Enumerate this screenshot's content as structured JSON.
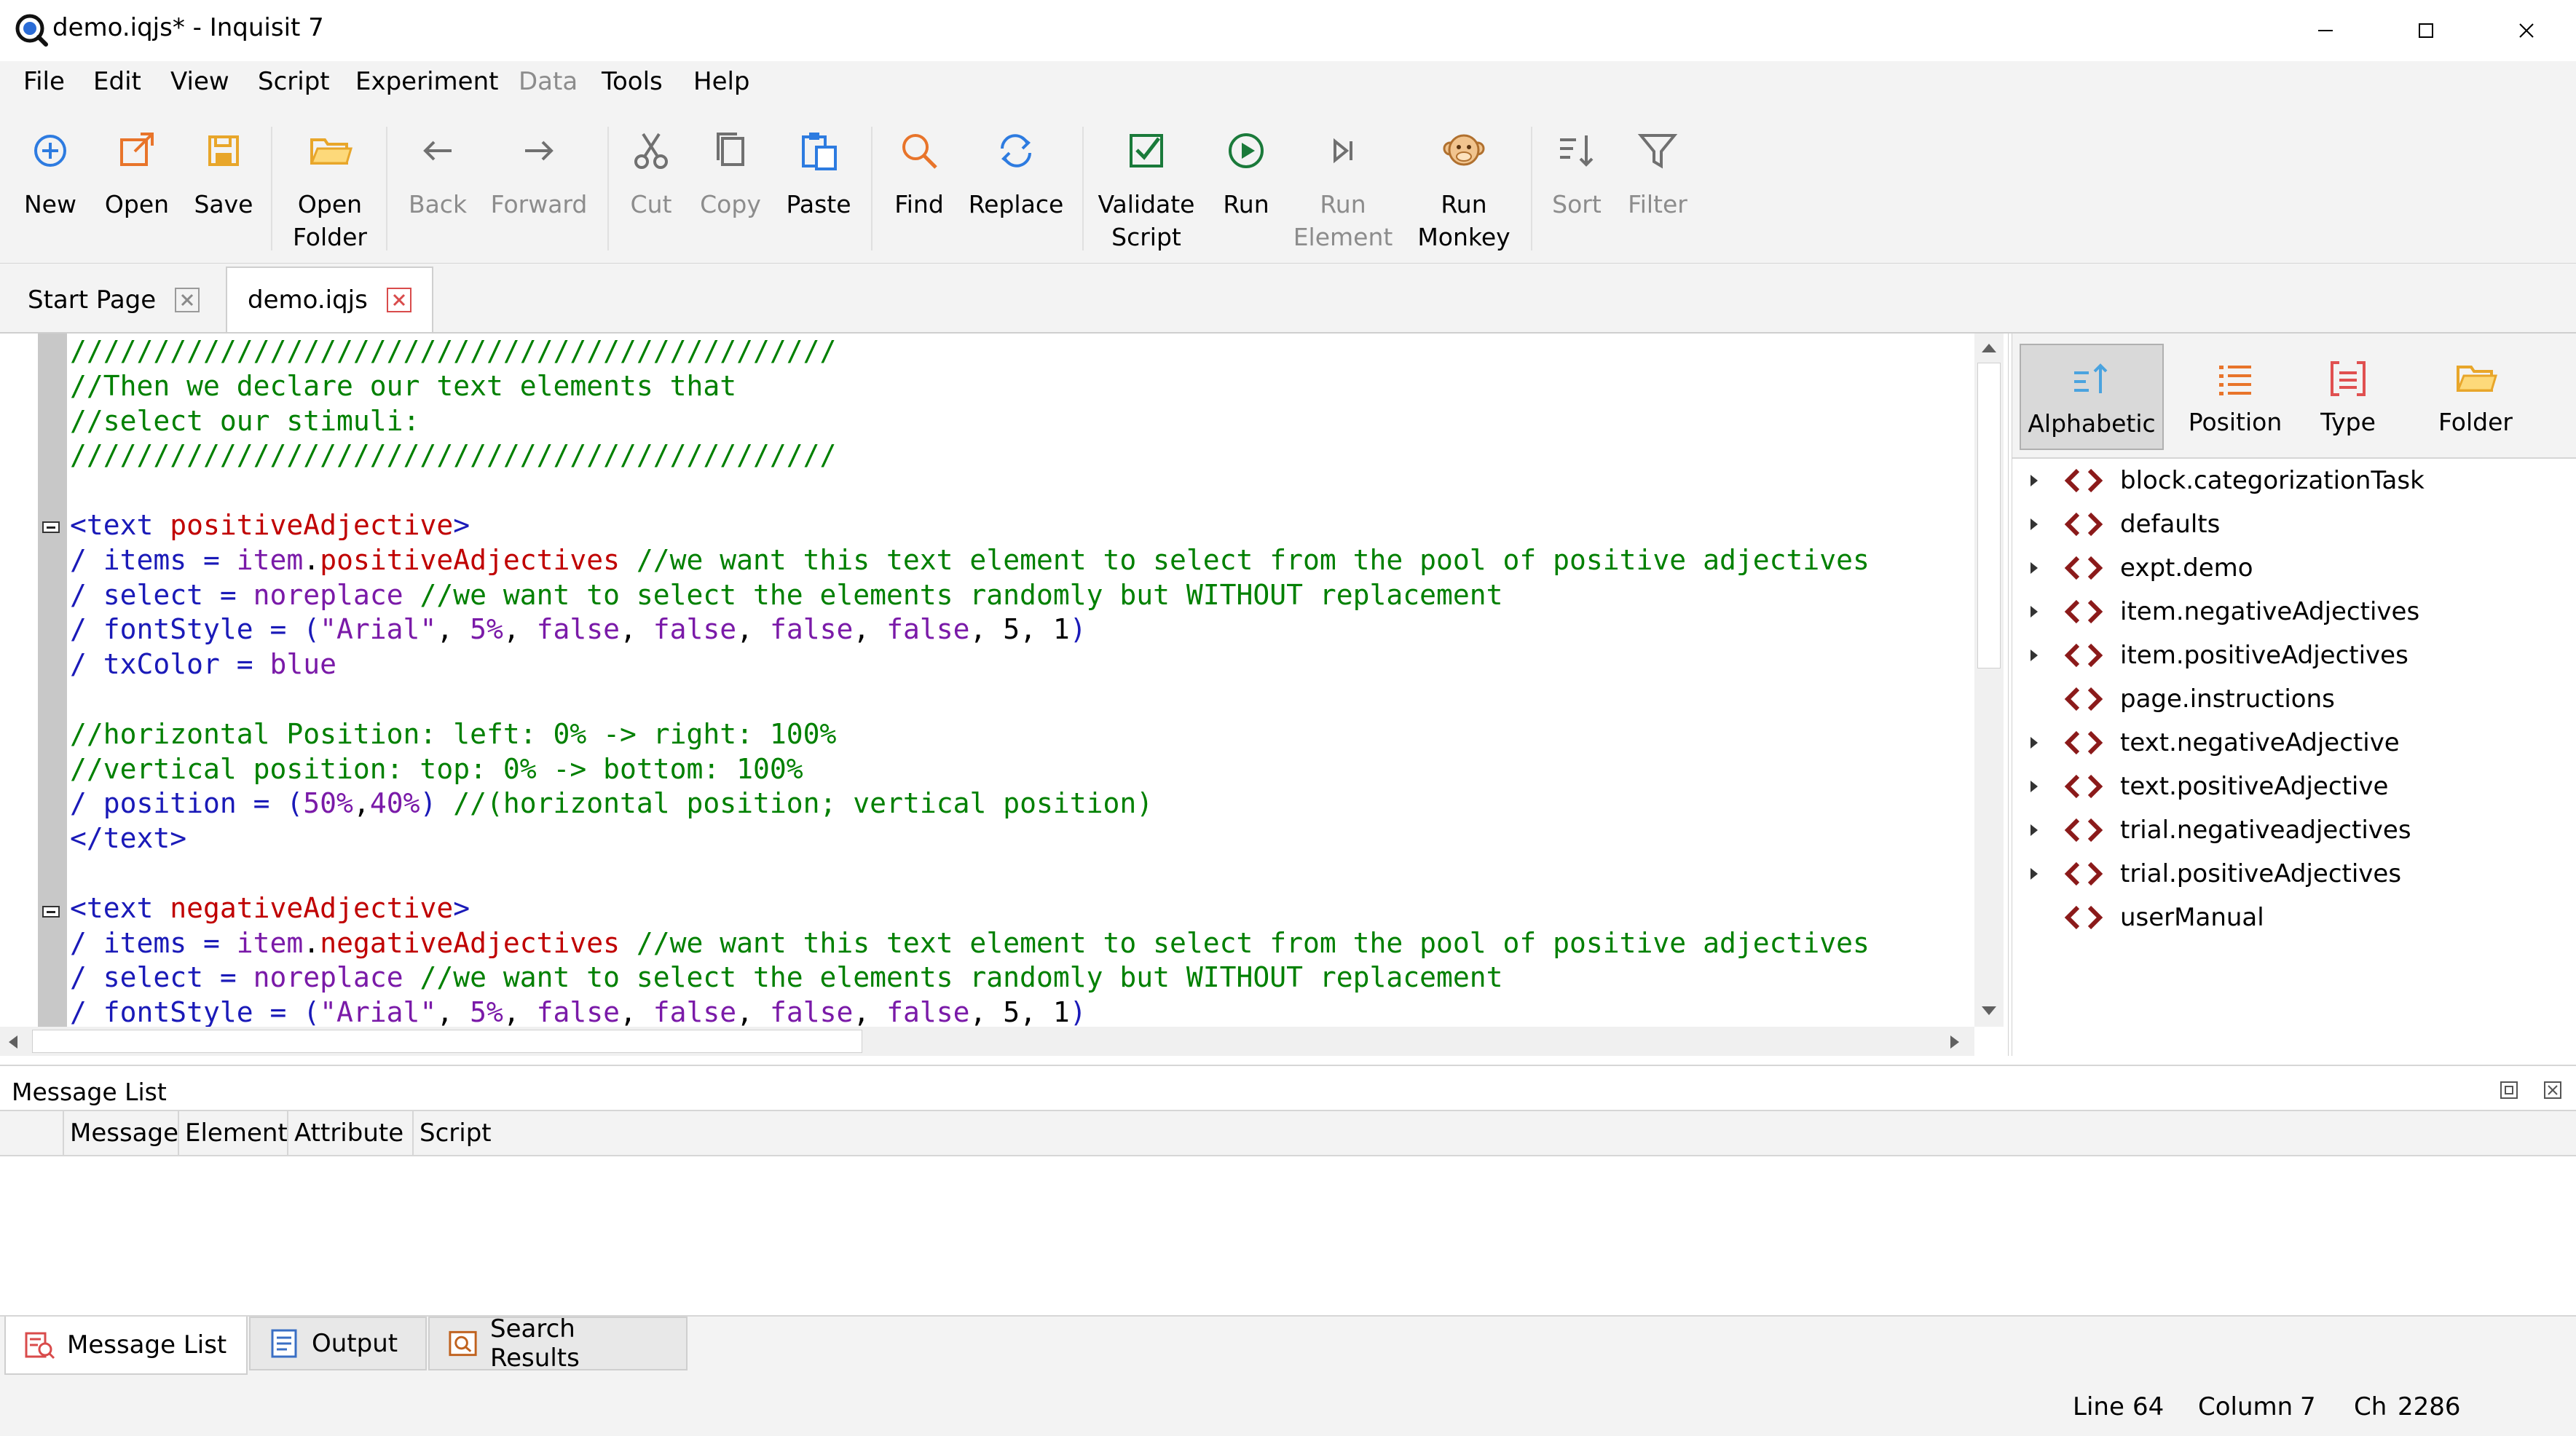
{
  "window": {
    "title": "demo.iqjs* - Inquisit 7",
    "controls": [
      "minimize",
      "maximize",
      "close"
    ]
  },
  "menu": [
    {
      "label": "File",
      "enabled": true
    },
    {
      "label": "Edit",
      "enabled": true
    },
    {
      "label": "View",
      "enabled": true
    },
    {
      "label": "Script",
      "enabled": true
    },
    {
      "label": "Experiment",
      "enabled": true
    },
    {
      "label": "Data",
      "enabled": false
    },
    {
      "label": "Tools",
      "enabled": true
    },
    {
      "label": "Help",
      "enabled": true
    }
  ],
  "toolbar": {
    "new": "New",
    "open": "Open",
    "save": "Save",
    "open_folder": "Open\nFolder",
    "back": "Back",
    "forward": "Forward",
    "cut": "Cut",
    "copy": "Copy",
    "paste": "Paste",
    "find": "Find",
    "replace": "Replace",
    "validate_script": "Validate\nScript",
    "run": "Run",
    "run_element": "Run\nElement",
    "run_monkey": "Run\nMonkey",
    "sort": "Sort",
    "filter": "Filter"
  },
  "tabs": [
    {
      "label": "Start Page",
      "active": false
    },
    {
      "label": "demo.iqjs",
      "active": true
    }
  ],
  "editor": {
    "lines": [
      [
        {
          "t": "//////////////////////////////////////////////",
          "c": "cm"
        }
      ],
      [
        {
          "t": "//Then we declare our text elements that",
          "c": "cm"
        }
      ],
      [
        {
          "t": "//select our stimuli:",
          "c": "cm"
        }
      ],
      [
        {
          "t": "//////////////////////////////////////////////",
          "c": "cm"
        }
      ],
      [],
      [
        {
          "t": "<text ",
          "c": "tg"
        },
        {
          "t": "positiveAdjective",
          "c": "nm"
        },
        {
          "t": ">",
          "c": "tg"
        }
      ],
      [
        {
          "t": "/ items = ",
          "c": "at"
        },
        {
          "t": "item",
          "c": "vl"
        },
        {
          "t": ".",
          "c": "pl"
        },
        {
          "t": "positiveAdjectives",
          "c": "nm"
        },
        {
          "t": " //we want this text element to select from the pool of positive adjectives",
          "c": "cm"
        }
      ],
      [
        {
          "t": "/ select = ",
          "c": "at"
        },
        {
          "t": "noreplace",
          "c": "vl"
        },
        {
          "t": " //we want to select the elements randomly but WITHOUT replacement",
          "c": "cm"
        }
      ],
      [
        {
          "t": "/ fontStyle = (",
          "c": "at"
        },
        {
          "t": "\"Arial\"",
          "c": "vl"
        },
        {
          "t": ", ",
          "c": "pl"
        },
        {
          "t": "5%",
          "c": "vl"
        },
        {
          "t": ", ",
          "c": "pl"
        },
        {
          "t": "false",
          "c": "vl"
        },
        {
          "t": ", ",
          "c": "pl"
        },
        {
          "t": "false",
          "c": "vl"
        },
        {
          "t": ", ",
          "c": "pl"
        },
        {
          "t": "false",
          "c": "vl"
        },
        {
          "t": ", ",
          "c": "pl"
        },
        {
          "t": "false",
          "c": "vl"
        },
        {
          "t": ", 5, 1",
          "c": "pl"
        },
        {
          "t": ")",
          "c": "at"
        }
      ],
      [
        {
          "t": "/ txColor = ",
          "c": "at"
        },
        {
          "t": "blue",
          "c": "vl"
        }
      ],
      [],
      [
        {
          "t": "//horizontal Position: left: 0% -> right: 100%",
          "c": "cm"
        }
      ],
      [
        {
          "t": "//vertical position: top: 0% -> bottom: 100%",
          "c": "cm"
        }
      ],
      [
        {
          "t": "/ position = (",
          "c": "at"
        },
        {
          "t": "50%",
          "c": "vl"
        },
        {
          "t": ",",
          "c": "pl"
        },
        {
          "t": "40%",
          "c": "vl"
        },
        {
          "t": ")",
          "c": "at"
        },
        {
          "t": " //(horizontal position; vertical position)",
          "c": "cm"
        }
      ],
      [
        {
          "t": "</text>",
          "c": "tg"
        }
      ],
      [],
      [
        {
          "t": "<text ",
          "c": "tg"
        },
        {
          "t": "negativeAdjective",
          "c": "nm"
        },
        {
          "t": ">",
          "c": "tg"
        }
      ],
      [
        {
          "t": "/ items = ",
          "c": "at"
        },
        {
          "t": "item",
          "c": "vl"
        },
        {
          "t": ".",
          "c": "pl"
        },
        {
          "t": "negativeAdjectives",
          "c": "nm"
        },
        {
          "t": " //we want this text element to select from the pool of positive adjectives",
          "c": "cm"
        }
      ],
      [
        {
          "t": "/ select = ",
          "c": "at"
        },
        {
          "t": "noreplace",
          "c": "vl"
        },
        {
          "t": " //we want to select the elements randomly but WITHOUT replacement",
          "c": "cm"
        }
      ],
      [
        {
          "t": "/ fontStyle = (",
          "c": "at"
        },
        {
          "t": "\"Arial\"",
          "c": "vl"
        },
        {
          "t": ", ",
          "c": "pl"
        },
        {
          "t": "5%",
          "c": "vl"
        },
        {
          "t": ", ",
          "c": "pl"
        },
        {
          "t": "false",
          "c": "vl"
        },
        {
          "t": ", ",
          "c": "pl"
        },
        {
          "t": "false",
          "c": "vl"
        },
        {
          "t": ", ",
          "c": "pl"
        },
        {
          "t": "false",
          "c": "vl"
        },
        {
          "t": ", ",
          "c": "pl"
        },
        {
          "t": "false",
          "c": "vl"
        },
        {
          "t": ", 5, 1",
          "c": "pl"
        },
        {
          "t": ")",
          "c": "at"
        }
      ]
    ]
  },
  "outline": {
    "sort_buttons": {
      "alphabetic": "Alphabetic",
      "position": "Position",
      "type": "Type",
      "folder": "Folder"
    },
    "items": [
      {
        "label": "block.categorizationTask",
        "expandable": true
      },
      {
        "label": "defaults",
        "expandable": true
      },
      {
        "label": "expt.demo",
        "expandable": true
      },
      {
        "label": "item.negativeAdjectives",
        "expandable": true
      },
      {
        "label": "item.positiveAdjectives",
        "expandable": true
      },
      {
        "label": "page.instructions",
        "expandable": false
      },
      {
        "label": "text.negativeAdjective",
        "expandable": true
      },
      {
        "label": "text.positiveAdjective",
        "expandable": true
      },
      {
        "label": "trial.negativeadjectives",
        "expandable": true
      },
      {
        "label": "trial.positiveAdjectives",
        "expandable": true
      },
      {
        "label": "userManual",
        "expandable": false
      }
    ]
  },
  "message_list": {
    "title": "Message List",
    "columns": [
      "Message",
      "Element",
      "Attribute",
      "Script"
    ]
  },
  "bottom_tabs": {
    "message_list": "Message List",
    "output": "Output",
    "search_results": "Search Results"
  },
  "status": {
    "line_label": "Line",
    "line": "64",
    "column_label": "Column",
    "column": "7",
    "ch_label": "Ch",
    "ch": "2286"
  }
}
